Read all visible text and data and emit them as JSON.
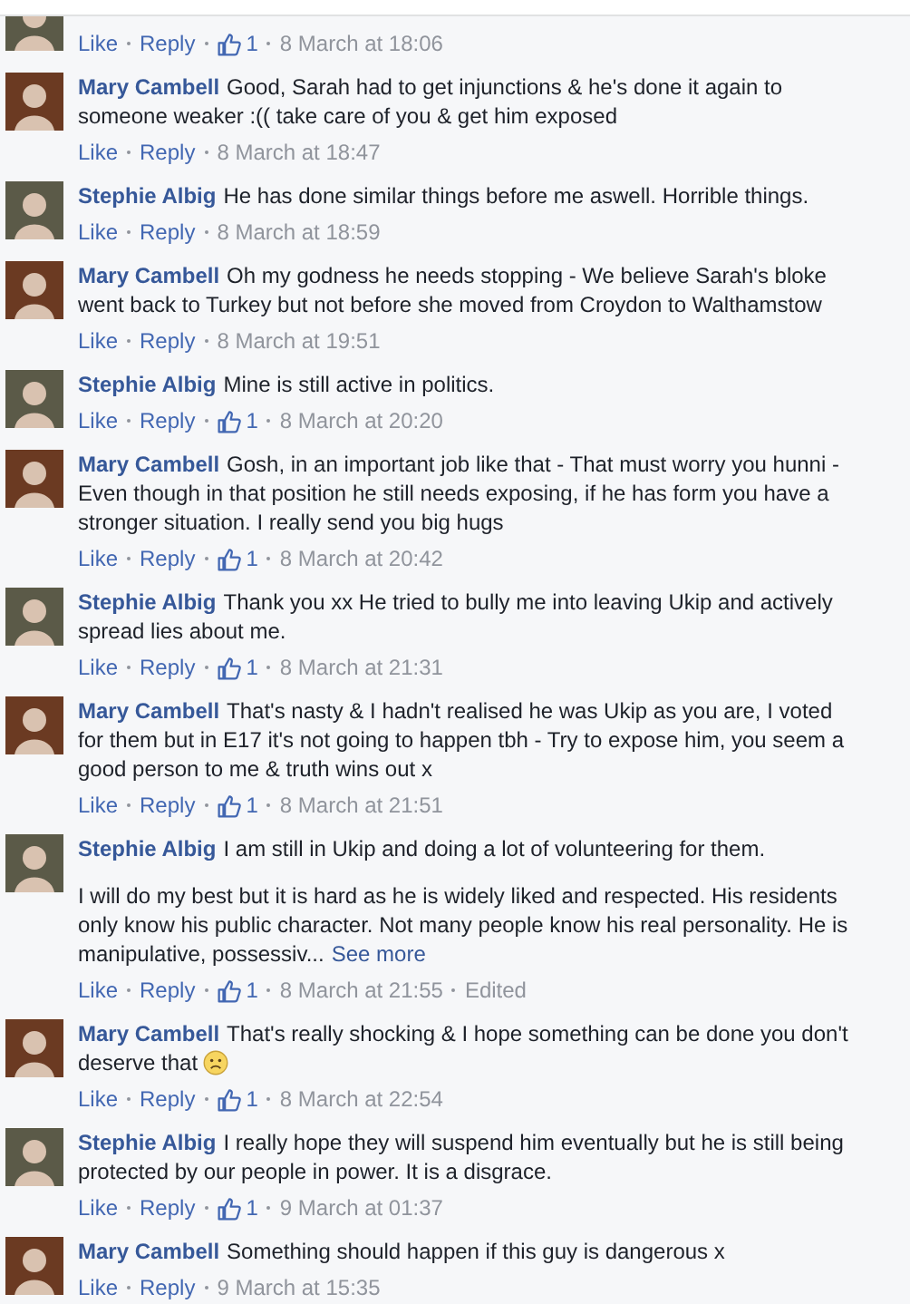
{
  "comments": [
    {
      "color": "#5b5a48",
      "actions": {
        "like": "Like",
        "reply": "Reply",
        "likes": "1",
        "time": "8 March at 18:06"
      }
    },
    {
      "author": "Mary Cambell",
      "color": "#6b3a22",
      "paragraphs": [
        {
          "text": "Good, Sarah had to get injunctions & he's done it again to someone weaker :(( take care of you & get him exposed"
        }
      ],
      "actions": {
        "like": "Like",
        "reply": "Reply",
        "time": "8 March at 18:47"
      }
    },
    {
      "author": "Stephie Albig",
      "color": "#5b5a48",
      "paragraphs": [
        {
          "text": "He has done similar things before me aswell. Horrible things."
        }
      ],
      "actions": {
        "like": "Like",
        "reply": "Reply",
        "time": "8 March at 18:59"
      }
    },
    {
      "author": "Mary Cambell",
      "color": "#6b3a22",
      "paragraphs": [
        {
          "text": "Oh my godness he needs stopping - We believe Sarah's bloke went back to Turkey but not before she moved from Croydon to Walthamstow"
        }
      ],
      "actions": {
        "like": "Like",
        "reply": "Reply",
        "time": "8 March at 19:51"
      }
    },
    {
      "author": "Stephie Albig",
      "color": "#5b5a48",
      "paragraphs": [
        {
          "text": "Mine is still active in politics."
        }
      ],
      "actions": {
        "like": "Like",
        "reply": "Reply",
        "likes": "1",
        "time": "8 March at 20:20"
      }
    },
    {
      "author": "Mary Cambell",
      "color": "#6b3a22",
      "paragraphs": [
        {
          "text": "Gosh, in an important job like that - That must worry you hunni - Even though in that position he still needs exposing, if he has form you have a stronger situation. I really send you big hugs"
        }
      ],
      "actions": {
        "like": "Like",
        "reply": "Reply",
        "likes": "1",
        "time": "8 March at 20:42"
      }
    },
    {
      "author": "Stephie Albig",
      "color": "#5b5a48",
      "paragraphs": [
        {
          "text": "Thank you xx He tried to bully me into leaving Ukip and actively spread lies about me."
        }
      ],
      "actions": {
        "like": "Like",
        "reply": "Reply",
        "likes": "1",
        "time": "8 March at 21:31"
      }
    },
    {
      "author": "Mary Cambell",
      "color": "#6b3a22",
      "paragraphs": [
        {
          "text": "That's nasty & I hadn't realised he was Ukip as you are, I voted for them but in E17 it's not going to happen tbh - Try to expose him, you seem a good person to me & truth wins out x"
        }
      ],
      "actions": {
        "like": "Like",
        "reply": "Reply",
        "likes": "1",
        "time": "8 March at 21:51"
      }
    },
    {
      "author": "Stephie Albig",
      "color": "#5b5a48",
      "paragraphs": [
        {
          "text": "I am still in Ukip and doing a lot of volunteering for them."
        },
        {
          "text": "I will do my best but it is hard as he is widely liked and respected. His residents only know his public character. Not many people know his real personality. He is manipulative, possessiv...",
          "see_more": "See more"
        }
      ],
      "actions": {
        "like": "Like",
        "reply": "Reply",
        "likes": "1",
        "time": "8 March at 21:55",
        "edited": "Edited"
      }
    },
    {
      "author": "Mary Cambell",
      "color": "#6b3a22",
      "paragraphs": [
        {
          "text": "That's really shocking & I hope something can be done you don't deserve that",
          "sad_emoji": true
        }
      ],
      "actions": {
        "like": "Like",
        "reply": "Reply",
        "likes": "1",
        "time": "8 March at 22:54"
      }
    },
    {
      "author": "Stephie Albig",
      "color": "#5b5a48",
      "paragraphs": [
        {
          "text": "I really hope they will suspend him eventually but he is still being protected by our people in power. It is a disgrace."
        }
      ],
      "actions": {
        "like": "Like",
        "reply": "Reply",
        "likes": "1",
        "time": "9 March at 01:37"
      }
    },
    {
      "author": "Mary Cambell",
      "color": "#6b3a22",
      "paragraphs": [
        {
          "text": "Something should happen if this guy is dangerous x"
        }
      ],
      "actions": {
        "like": "Like",
        "reply": "Reply",
        "time": "9 March at 15:35"
      }
    }
  ]
}
